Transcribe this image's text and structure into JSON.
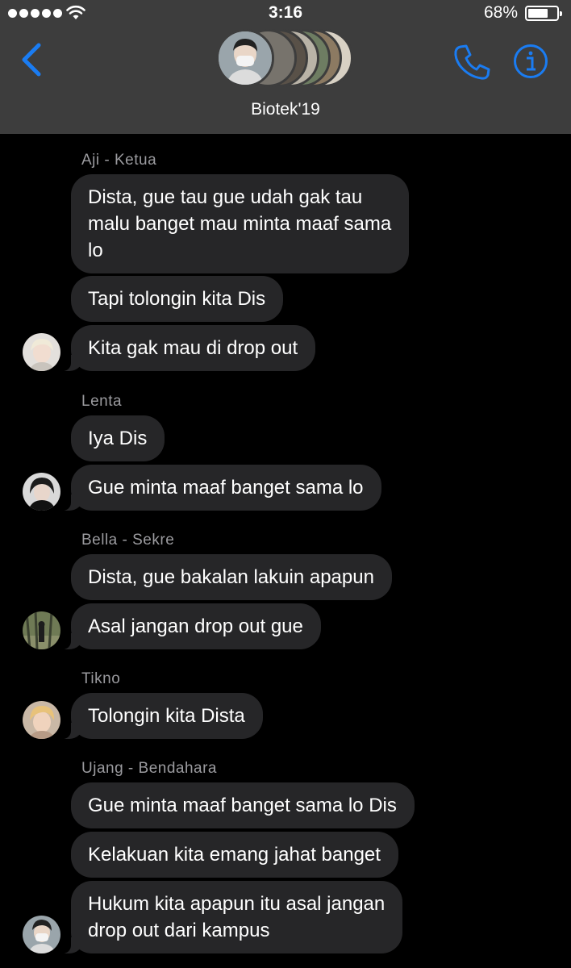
{
  "status_bar": {
    "time": "3:16",
    "battery_percent": "68%",
    "battery_level": 0.68,
    "signal_dots": 5
  },
  "header": {
    "group_name": "Biotek'19",
    "accent_color": "#1a7cf2",
    "icons": [
      "back-chevron-icon",
      "phone-icon",
      "info-icon"
    ]
  },
  "messages": [
    {
      "sender": "Aji - Ketua",
      "bubbles": [
        [
          "Dista, gue tau gue udah gak tau",
          "malu banget mau minta maaf sama",
          "lo"
        ],
        [
          "Tapi tolongin kita Dis"
        ],
        [
          "Kita gak mau di drop out"
        ]
      ]
    },
    {
      "sender": "Lenta",
      "bubbles": [
        [
          "Iya Dis"
        ],
        [
          "Gue minta maaf banget sama lo"
        ]
      ]
    },
    {
      "sender": "Bella - Sekre",
      "bubbles": [
        [
          "Dista, gue bakalan lakuin apapun"
        ],
        [
          "Asal jangan drop out gue"
        ]
      ]
    },
    {
      "sender": "Tikno",
      "bubbles": [
        [
          "Tolongin kita Dista"
        ]
      ]
    },
    {
      "sender": "Ujang - Bendahara",
      "bubbles": [
        [
          "Gue minta maaf banget sama lo Dis"
        ],
        [
          "Kelakuan kita emang jahat banget"
        ],
        [
          "Hukum kita apapun itu asal jangan",
          "drop out dari kampus"
        ]
      ]
    }
  ]
}
